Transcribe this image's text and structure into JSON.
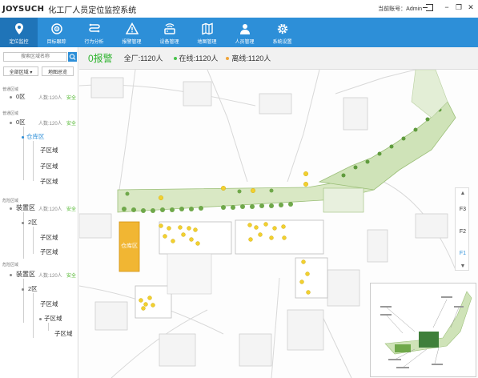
{
  "header": {
    "logo": "JOYSUCH",
    "title": "化工厂人员定位监控系统",
    "account": "当前账号：Admin",
    "min_label": "−",
    "max_label": "❐",
    "close_label": "✕"
  },
  "nav": [
    {
      "label": "定位监控",
      "icon": "location-pin-icon"
    },
    {
      "label": "目标跟踪",
      "icon": "target-track-icon"
    },
    {
      "label": "行为分析",
      "icon": "behavior-analysis-icon"
    },
    {
      "label": "报警管理",
      "icon": "alarm-warning-icon"
    },
    {
      "label": "设备管理",
      "icon": "device-icon"
    },
    {
      "label": "地图管理",
      "icon": "map-icon"
    },
    {
      "label": "人员管理",
      "icon": "person-icon"
    },
    {
      "label": "系统设置",
      "icon": "settings-icon"
    }
  ],
  "sidebar": {
    "search_placeholder": "搜索区域名称",
    "btn_all_area": "全部区域 ▾",
    "btn_map_overview": "地图总览",
    "sections": [
      {
        "label": "普通区域",
        "node": "0区",
        "meta": "人数:120人",
        "safe": "安全"
      },
      {
        "label": "普通区域",
        "node": "0区",
        "meta": "人数:120人",
        "safe": "安全",
        "children": [
          "仓库区",
          "子区域",
          "子区域",
          "子区域"
        ]
      },
      {
        "label": "危险区域",
        "node": "装置区",
        "meta": "人数:120人",
        "safe": "安全",
        "children": [
          "2区",
          "子区域",
          "子区域"
        ]
      },
      {
        "label": "危险区域",
        "node": "装置区",
        "meta": "人数:120人",
        "safe": "安全",
        "children": [
          "2区",
          "子区域",
          "子区域",
          "子区域"
        ]
      }
    ],
    "section4_child4": "子区域"
  },
  "status": {
    "alarm": "0报警",
    "total": "全厂:1120人",
    "online": "在线:1120人",
    "offline": "离线:1120人"
  },
  "map": {
    "warehouse_label": "仓库区",
    "floors": [
      "F3",
      "F2",
      "F1"
    ],
    "active_floor": "F1"
  },
  "colors": {
    "nav_bg": "#2d8fd8",
    "nav_active": "#1f74b8",
    "safe": "#52b830",
    "warehouse": "#f1b633",
    "person_marker": "#f2d02f"
  }
}
